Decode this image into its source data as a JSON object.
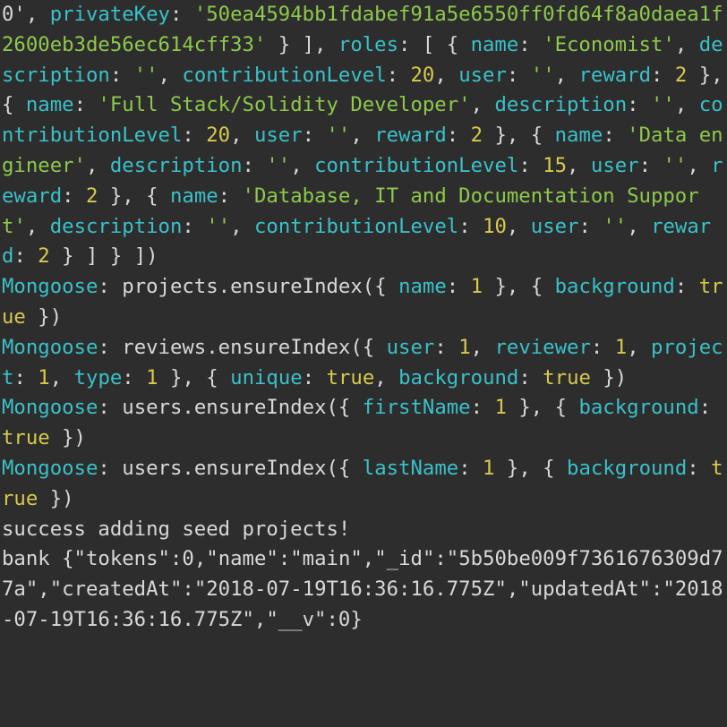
{
  "priv_tail": "4f8a0daea1f2600eb3de56ec614cff33",
  "roles": [
    {
      "name": "Economist",
      "contributionLevel": 20,
      "reward": 2
    },
    {
      "name": "Full Stack/Solidity Developer",
      "contributionLevel": 20,
      "reward": 2
    },
    {
      "name": "Data engineer",
      "contributionLevel": 15,
      "reward": 2
    },
    {
      "name": "Database, IT and Documentation Support",
      "contributionLevel": 10,
      "reward": 2
    }
  ],
  "mongoose": [
    {
      "coll": "projects",
      "fields": "name: 1",
      "opts": "background: true"
    },
    {
      "coll": "reviews",
      "fields": "user: 1, reviewer: 1, project: 1, type: 1",
      "opts": "unique: true, background: true"
    },
    {
      "coll": "users",
      "fields": "firstName: 1",
      "opts": "background: true"
    },
    {
      "coll": "users",
      "fields": "lastName: 1",
      "opts": "background: true"
    }
  ],
  "success_msg": "success adding seed projects!",
  "bank": {
    "tokens": 0,
    "name": "main",
    "_id": "5b50be009f7361676309d77a",
    "createdAt": "2018-07-19T16:36:16.775Z",
    "updatedAt": "2018-07-19T16:36:16.775Z",
    "__v": 0
  },
  "labels": {
    "privateKey": "privateKey",
    "roles": "roles",
    "name": "name",
    "description": "description",
    "contributionLevel": "contributionLevel",
    "user": "user",
    "reward": "reward",
    "Mongoose": "Mongoose",
    "ensureIndex": "ensureIndex",
    "background": "background",
    "unique": "unique",
    "true": "true",
    "bank": "bank",
    "tokens": "tokens",
    "_id": "_id",
    "createdAt": "createdAt",
    "updatedAt": "updatedAt",
    "__v": "__v"
  },
  "nums": {
    "one": 1
  }
}
